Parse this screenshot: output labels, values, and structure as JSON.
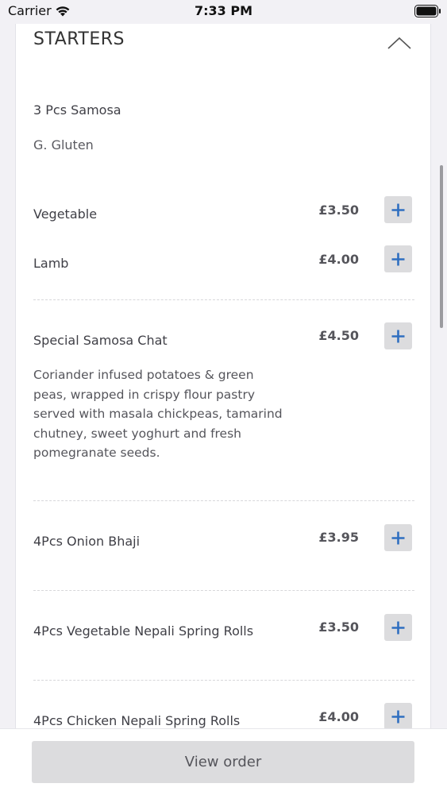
{
  "status_bar": {
    "carrier": "Carrier",
    "time": "7:33 PM",
    "wifi_icon": "wifi-icon",
    "battery_icon": "battery-icon"
  },
  "section": {
    "title": "STARTERS",
    "collapse_icon": "chevron-up-icon"
  },
  "groups": [
    {
      "title": "3 Pcs Samosa",
      "allergen": "G. Gluten",
      "items": [
        {
          "name": "Vegetable",
          "price": "£3.50"
        },
        {
          "name": "Lamb",
          "price": "£4.00"
        }
      ]
    }
  ],
  "items": [
    {
      "name": "Special Samosa Chat",
      "price": "£4.50",
      "description": "Coriander infused potatoes & green peas, wrapped in crispy flour pastry served with masala chickpeas, tamarind chutney, sweet yoghurt and fresh pomegranate seeds."
    },
    {
      "name": "4Pcs Onion Bhaji",
      "price": "£3.95"
    },
    {
      "name": "4Pcs Vegetable Nepali Spring Rolls",
      "price": "£3.50"
    },
    {
      "name": "4Pcs Chicken Nepali Spring Rolls",
      "price": "£4.00"
    }
  ],
  "add_icon": "plus-icon",
  "footer": {
    "button_label": "View order"
  },
  "colors": {
    "accent": "#2f6fc0",
    "button_bg": "#dcdcde",
    "page_bg": "#f2f1f5"
  }
}
